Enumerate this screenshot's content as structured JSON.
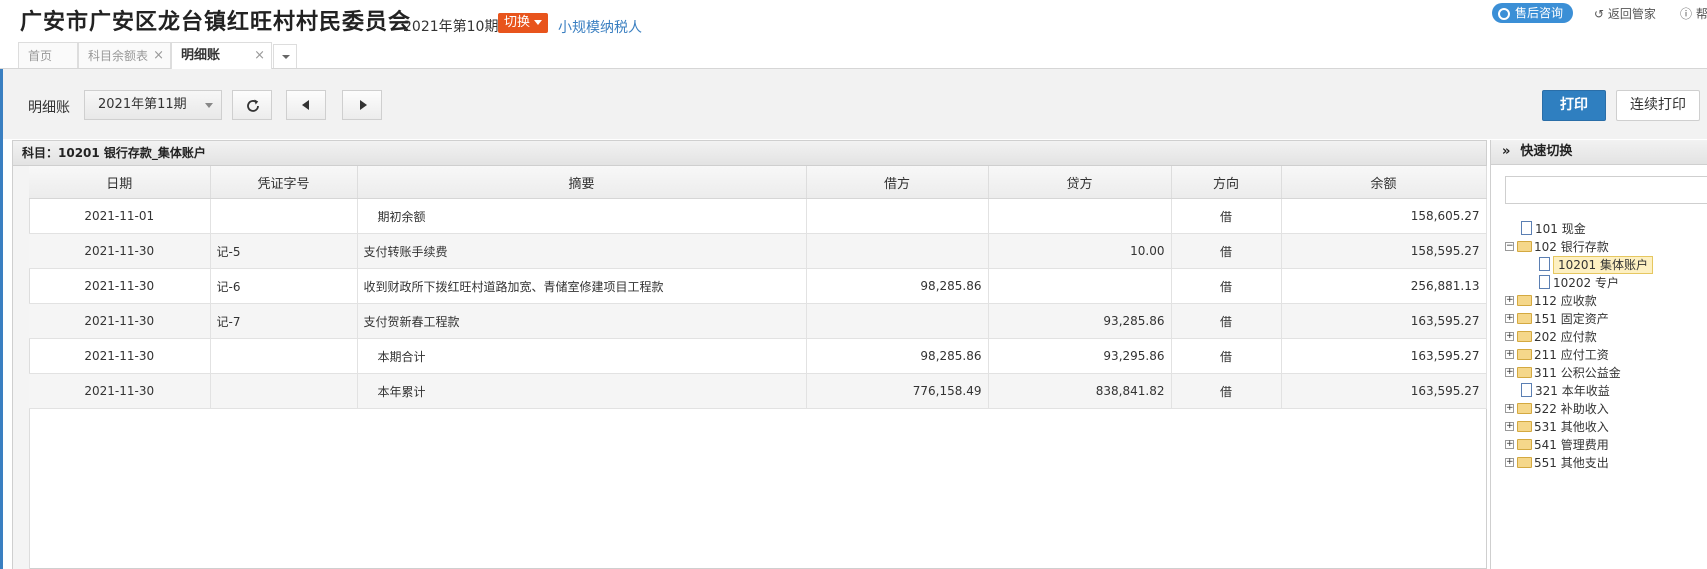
{
  "header": {
    "company": "广安市广安区龙台镇红旺村村民委员会",
    "period": "2021年第10期",
    "switch_label": "切换",
    "taxpayer": "小规模纳税人",
    "support": "售后咨询",
    "back": "返回管家",
    "help": "帮"
  },
  "tabs": [
    {
      "label": "首页"
    },
    {
      "label": "科目余额表"
    },
    {
      "label": "明细账"
    }
  ],
  "toolbar": {
    "title": "明细账",
    "period_value": "2021年第11期",
    "print": "打印",
    "continuous_print": "连续打印"
  },
  "ledger": {
    "subject": "科目：10201 银行存款_集体账户",
    "columns": [
      "日期",
      "凭证字号",
      "摘要",
      "借方",
      "贷方",
      "方向",
      "余额"
    ],
    "rows": [
      {
        "date": "2021-11-01",
        "voucher": "",
        "summary": "期初余额",
        "debit": "",
        "credit": "",
        "dir": "借",
        "balance": "158,605.27"
      },
      {
        "date": "2021-11-30",
        "voucher": "记-5",
        "summary": "支付转账手续费",
        "debit": "",
        "credit": "10.00",
        "dir": "借",
        "balance": "158,595.27"
      },
      {
        "date": "2021-11-30",
        "voucher": "记-6",
        "summary": "收到财政所下拨红旺村道路加宽、青储室修建项目工程款",
        "debit": "98,285.86",
        "credit": "",
        "dir": "借",
        "balance": "256,881.13"
      },
      {
        "date": "2021-11-30",
        "voucher": "记-7",
        "summary": "支付贺新春工程款",
        "debit": "",
        "credit": "93,285.86",
        "dir": "借",
        "balance": "163,595.27"
      },
      {
        "date": "2021-11-30",
        "voucher": "",
        "summary": "本期合计",
        "debit": "98,285.86",
        "credit": "93,295.86",
        "dir": "借",
        "balance": "163,595.27"
      },
      {
        "date": "2021-11-30",
        "voucher": "",
        "summary": "本年累计",
        "debit": "776,158.49",
        "credit": "838,841.82",
        "dir": "借",
        "balance": "163,595.27"
      }
    ]
  },
  "sidebar": {
    "title": "快速切换",
    "tree": [
      {
        "label": "101 现金",
        "kind": "doc",
        "level": 0,
        "toggle": ""
      },
      {
        "label": "102 银行存款",
        "kind": "folder",
        "level": 0,
        "toggle": "−"
      },
      {
        "label": "10201 集体账户",
        "kind": "doc",
        "level": 1,
        "toggle": "",
        "selected": true
      },
      {
        "label": "10202 专户",
        "kind": "doc",
        "level": 1,
        "toggle": ""
      },
      {
        "label": "112 应收款",
        "kind": "folder",
        "level": 0,
        "toggle": "+"
      },
      {
        "label": "151 固定资产",
        "kind": "folder",
        "level": 0,
        "toggle": "+"
      },
      {
        "label": "202 应付款",
        "kind": "folder",
        "level": 0,
        "toggle": "+"
      },
      {
        "label": "211 应付工资",
        "kind": "folder",
        "level": 0,
        "toggle": "+"
      },
      {
        "label": "311 公积公益金",
        "kind": "folder",
        "level": 0,
        "toggle": "+"
      },
      {
        "label": "321 本年收益",
        "kind": "doc",
        "level": 0,
        "toggle": ""
      },
      {
        "label": "522 补助收入",
        "kind": "folder",
        "level": 0,
        "toggle": "+"
      },
      {
        "label": "531 其他收入",
        "kind": "folder",
        "level": 0,
        "toggle": "+"
      },
      {
        "label": "541 管理费用",
        "kind": "folder",
        "level": 0,
        "toggle": "+"
      },
      {
        "label": "551 其他支出",
        "kind": "folder",
        "level": 0,
        "toggle": "+"
      }
    ]
  }
}
